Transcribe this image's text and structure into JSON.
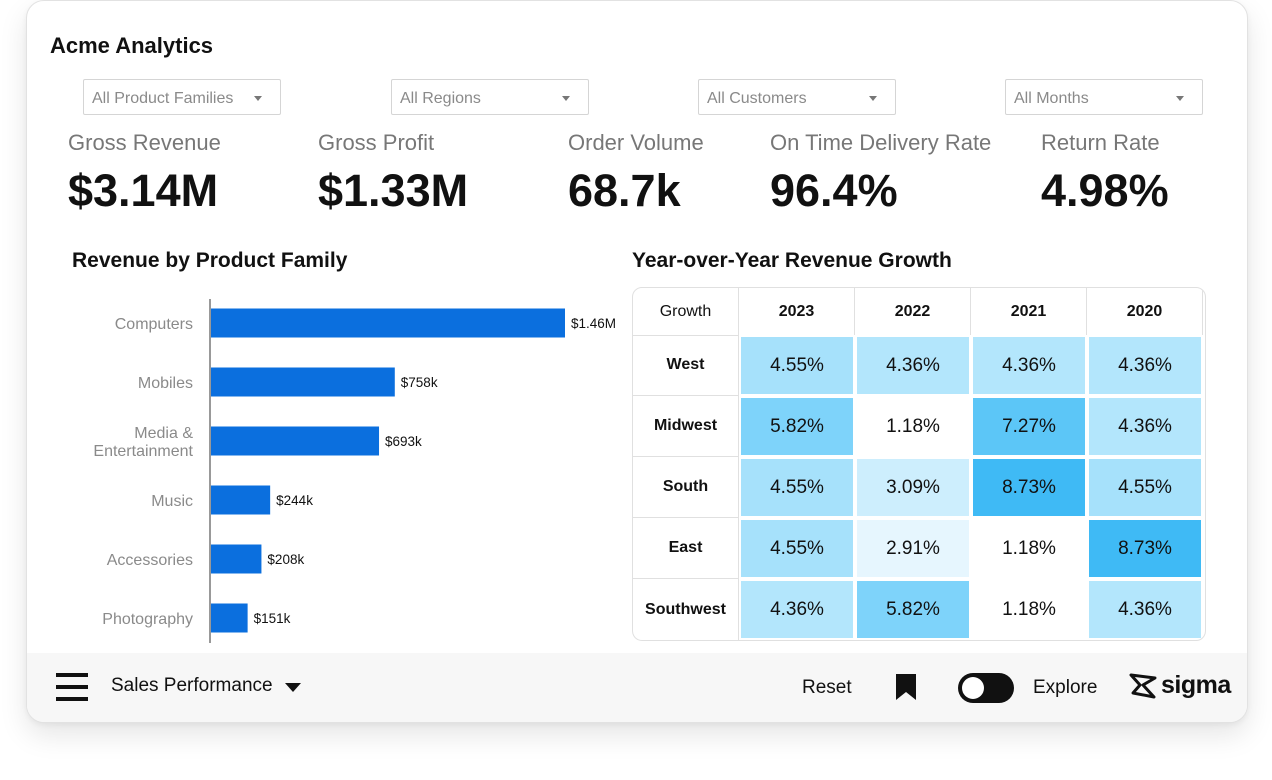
{
  "app": {
    "title": "Acme Analytics"
  },
  "filters": [
    {
      "label": "All Product Families"
    },
    {
      "label": "All Regions"
    },
    {
      "label": "All Customers"
    },
    {
      "label": "All Months"
    }
  ],
  "kpis": [
    {
      "label": "Gross Revenue",
      "value": "$3.14M"
    },
    {
      "label": "Gross Profit",
      "value": "$1.33M"
    },
    {
      "label": "Order Volume",
      "value": "68.7k"
    },
    {
      "label": "On Time Delivery Rate",
      "value": "96.4%"
    },
    {
      "label": "Return Rate",
      "value": "4.98%"
    }
  ],
  "revenue_chart": {
    "title": "Revenue by Product Family",
    "bar_color": "#0b6fde"
  },
  "chart_data": {
    "type": "bar",
    "orientation": "horizontal",
    "title": "Revenue by Product Family",
    "categories": [
      [
        "Computers"
      ],
      [
        "Mobiles"
      ],
      [
        "Media &",
        "Entertainment"
      ],
      [
        "Music"
      ],
      [
        "Accessories"
      ],
      [
        "Photography"
      ]
    ],
    "values": [
      1460000,
      758000,
      693000,
      244000,
      208000,
      151000
    ],
    "value_labels": [
      "$1.46M",
      "$758k",
      "$693k",
      "$244k",
      "$208k",
      "$151k"
    ],
    "grid": false
  },
  "growth_table": {
    "title": "Year-over-Year Revenue Growth",
    "corner_label": "Growth",
    "columns": [
      "2023",
      "2022",
      "2021",
      "2020"
    ],
    "rows": [
      {
        "label": "West",
        "cells": [
          "4.55%",
          "4.36%",
          "4.36%",
          "4.36%"
        ]
      },
      {
        "label": "Midwest",
        "cells": [
          "5.82%",
          "1.18%",
          "7.27%",
          "4.36%"
        ]
      },
      {
        "label": "South",
        "cells": [
          "4.55%",
          "3.09%",
          "8.73%",
          "4.55%"
        ]
      },
      {
        "label": "East",
        "cells": [
          "4.55%",
          "2.91%",
          "1.18%",
          "8.73%"
        ]
      },
      {
        "label": "Southwest",
        "cells": [
          "4.36%",
          "5.82%",
          "1.18%",
          "4.36%"
        ]
      }
    ],
    "colors": {
      "1.18%": "#ffffff",
      "2.91%": "#e6f6fe",
      "3.09%": "#cdeefd",
      "4.36%": "#b3e6fc",
      "4.55%": "#a6e1fb",
      "5.82%": "#7ed3fa",
      "7.27%": "#5cc6f7",
      "8.73%": "#3fbaf5"
    }
  },
  "footer": {
    "workbook_name": "Sales Performance",
    "reset_label": "Reset",
    "explore_label": "Explore",
    "logo_text": "sigma"
  }
}
